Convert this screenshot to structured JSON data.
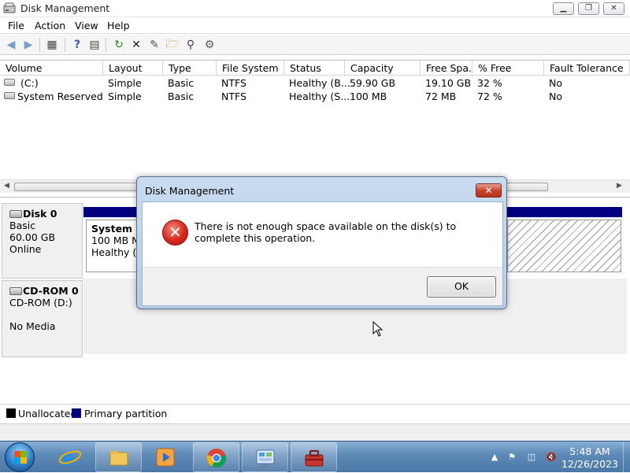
{
  "window": {
    "title": "Disk Management",
    "controls": {
      "minimize": "▁",
      "maximize": "❐",
      "close": "✕"
    }
  },
  "menu": {
    "items": [
      "File",
      "Action",
      "View",
      "Help"
    ]
  },
  "toolbar": {
    "buttons": [
      "back-icon",
      "forward-icon",
      "properties-grid-icon",
      "help-icon",
      "list-icon",
      "refresh-icon",
      "delete-icon",
      "properties-icon",
      "open-icon",
      "explore-icon",
      "settings-icon"
    ]
  },
  "volume_table": {
    "columns": [
      "Volume",
      "Layout",
      "Type",
      "File System",
      "Status",
      "Capacity",
      "Free Spa...",
      "% Free",
      "Fault Tolerance"
    ],
    "rows": [
      [
        "(C:)",
        "Simple",
        "Basic",
        "NTFS",
        "Healthy (B...",
        "59.90 GB",
        "19.10 GB",
        "32 %",
        "No"
      ],
      [
        "System Reserved",
        "Simple",
        "Basic",
        "NTFS",
        "Healthy (S...",
        "100 MB",
        "72 MB",
        "72 %",
        "No"
      ]
    ]
  },
  "disks": {
    "disk0": {
      "name": "Disk 0",
      "type": "Basic",
      "size": "60.00 GB",
      "state": "Online",
      "partition": {
        "name": "System Re",
        "detail": "100 MB NT",
        "status": "Healthy (Sy"
      }
    },
    "cdrom0": {
      "name": "CD-ROM 0",
      "drive": "CD-ROM (D:)",
      "media": "No Media"
    }
  },
  "legend": {
    "unallocated": "Unallocated",
    "primary": "Primary partition",
    "colors": {
      "unallocated": "#000000",
      "primary": "#000080"
    }
  },
  "dialog": {
    "title": "Disk Management",
    "close": "✕",
    "icon": "error-icon",
    "message": "There is not enough space available on the disk(s) to complete this operation.",
    "ok": "OK"
  },
  "taskbar": {
    "apps": [
      "file-explorer-icon",
      "internet-explorer-icon",
      "media-player-icon",
      "chrome-icon",
      "control-panel-icon",
      "toolbox-icon"
    ],
    "clock": {
      "time": "5:48 AM",
      "date": "12/26/2023"
    },
    "tray": [
      "show-hidden-icons-arrow",
      "flag-icon",
      "network-icon",
      "volume-muted-icon"
    ]
  }
}
